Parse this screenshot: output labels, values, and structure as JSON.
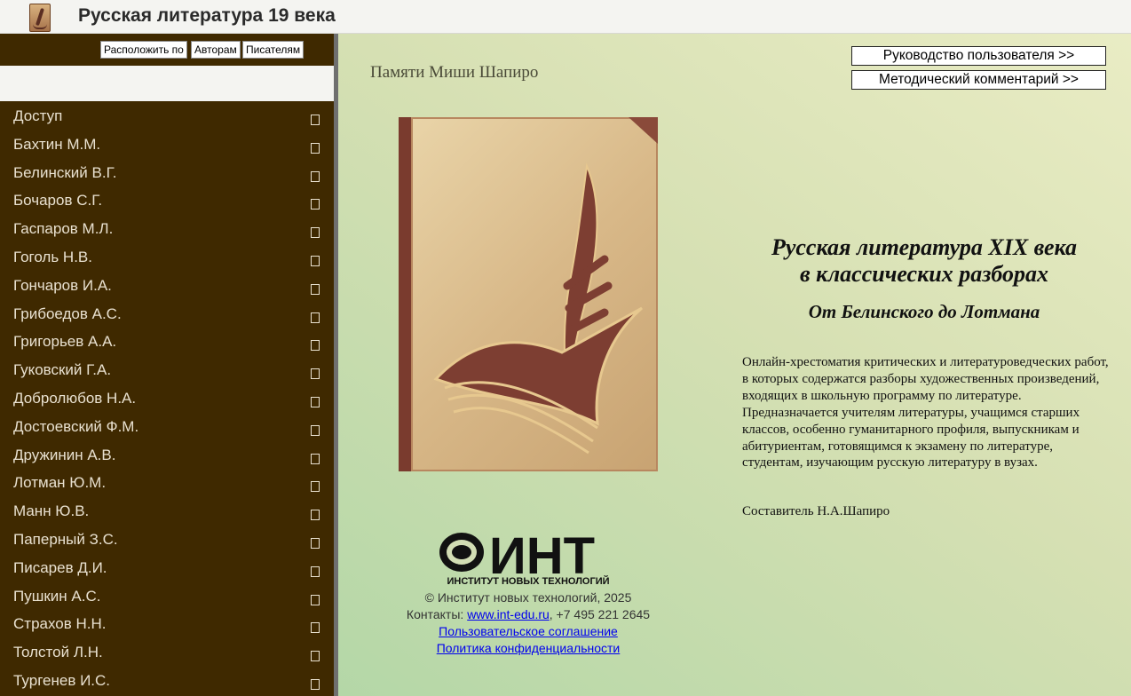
{
  "app": {
    "title": "Русская литература 19 века",
    "icon": "quill-book-icon"
  },
  "sidebar": {
    "sort_buttons": [
      "Расположить по",
      "Авторам",
      "Писателям"
    ],
    "authors": [
      "Доступ",
      "Бахтин М.М.",
      "Белинский В.Г.",
      "Бочаров С.Г.",
      "Гаспаров М.Л.",
      "Гоголь Н.В.",
      "Гончаров И.А.",
      "Грибоедов А.С.",
      "Григорьев А.А.",
      "Гуковский Г.А.",
      "Добролюбов Н.А.",
      "Достоевский Ф.М.",
      "Дружинин А.В.",
      "Лотман Ю.М.",
      "Манн Ю.В.",
      "Паперный З.С.",
      "Писарев Д.И.",
      "Пушкин А.С.",
      "Страхов Н.Н.",
      "Толстой Л.Н.",
      "Тургенев И.С."
    ],
    "colors": {
      "background": "#3f2900",
      "text": "#e9e1d0"
    }
  },
  "main": {
    "dedication": "Памяти Миши Шапиро",
    "guide_buttons": [
      "Руководство пользователя >>",
      "Методический комментарий >>"
    ],
    "book": {
      "title_line1": "Русская литература XIX века",
      "title_line2": "в классических разборах",
      "subtitle": "От Белинского до Лотмана",
      "description": "Онлайн-хрестоматия критических и литературоведческих работ, в которых содержатся разборы художественных произведений, входящих в школьную программу по литературе. Предназначается учителям литературы, учащимся старших классов, особенно гуманитарного профиля, выпускникам и абитуриентам, готовящимся к экзамену по литературе, студентам, изучающим русскую литературу в вузах.",
      "compiler": "Составитель Н.А.Шапиро"
    },
    "footer": {
      "logo_text": "ИНТ",
      "logo_caption": "ИНСТИТУТ НОВЫХ ТЕХНОЛОГИЙ",
      "copyright": "© Институт новых технологий, 2025",
      "contacts_label": "Контакты:",
      "site_link": "www.int-edu.ru",
      "phone": ", +7 495 221 2645",
      "user_agreement": "Пользовательское соглашение",
      "privacy_policy": "Политика конфиденциальности"
    }
  }
}
